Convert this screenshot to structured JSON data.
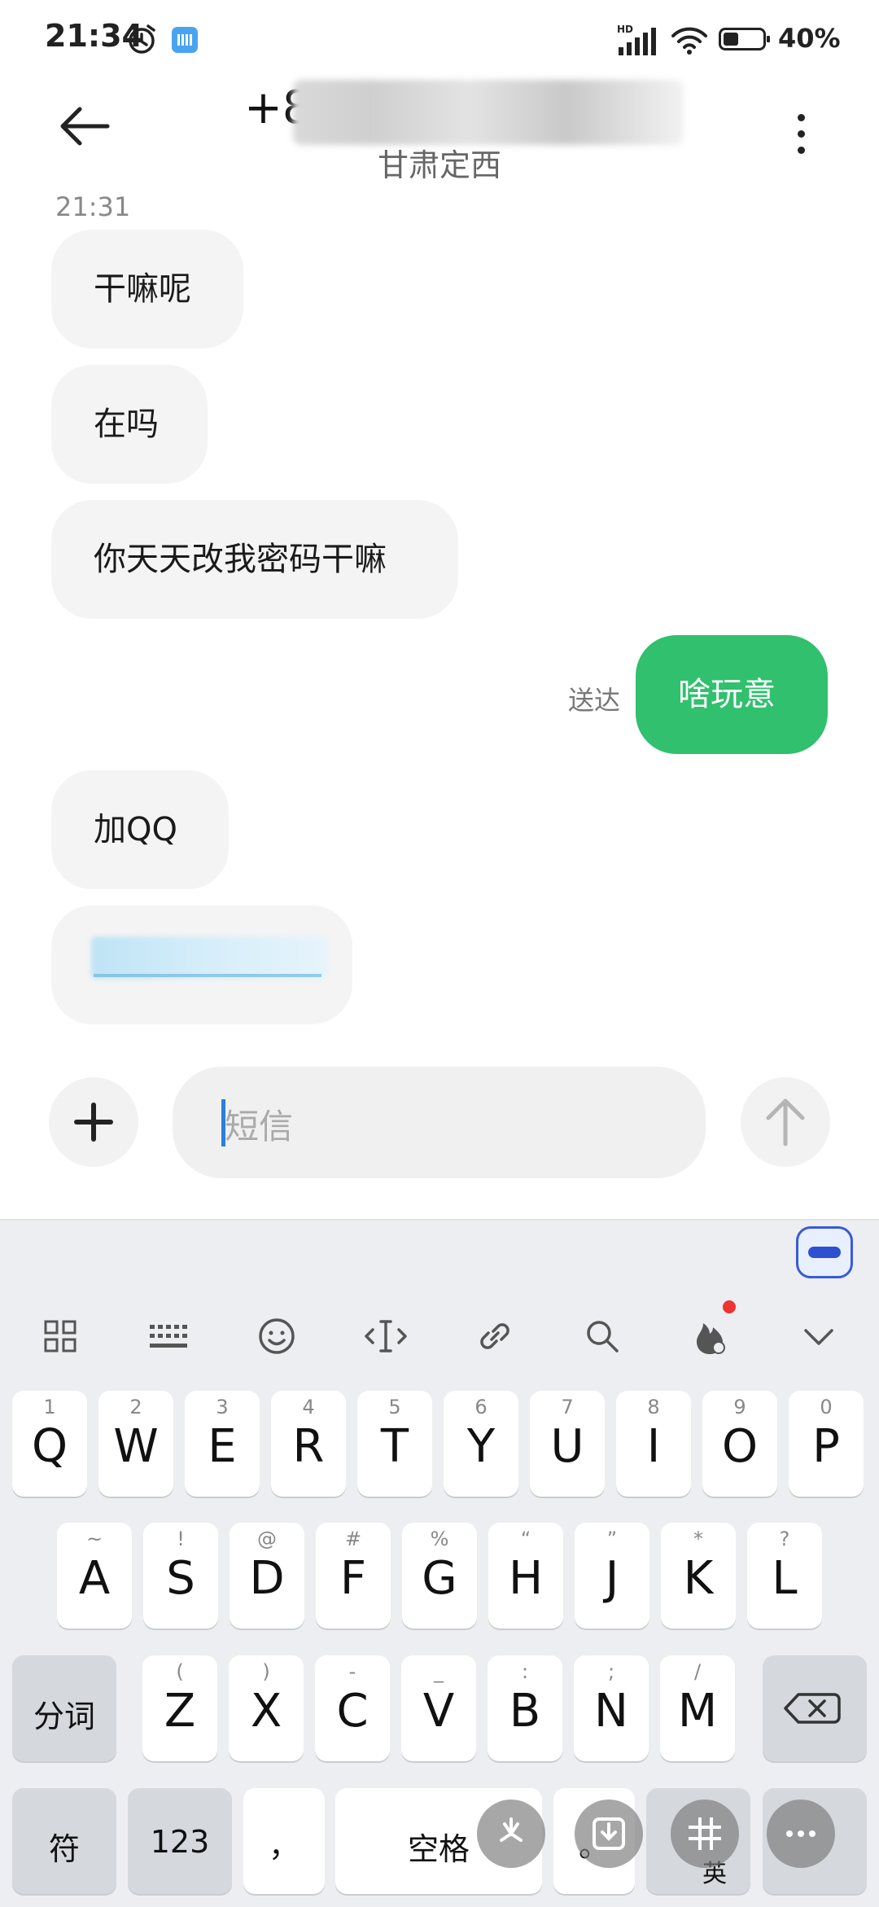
{
  "status": {
    "time": "21:34",
    "network": "HD",
    "battery_pct": "40%",
    "battery_level": 0.4
  },
  "header": {
    "number_visible": "+8",
    "location": "甘肃定西"
  },
  "messages": {
    "timestamp": "21:31",
    "m1": "干嘛呢",
    "m2": "在吗",
    "m3": "你天天改我密码干嘛",
    "sent": "啥玩意",
    "delivered": "送达",
    "m4": "加QQ"
  },
  "composer": {
    "placeholder": "短信"
  },
  "keyboard": {
    "row1": [
      {
        "sub": "1",
        "key": "Q"
      },
      {
        "sub": "2",
        "key": "W"
      },
      {
        "sub": "3",
        "key": "E"
      },
      {
        "sub": "4",
        "key": "R"
      },
      {
        "sub": "5",
        "key": "T"
      },
      {
        "sub": "6",
        "key": "Y"
      },
      {
        "sub": "7",
        "key": "U"
      },
      {
        "sub": "8",
        "key": "I"
      },
      {
        "sub": "9",
        "key": "O"
      },
      {
        "sub": "0",
        "key": "P"
      }
    ],
    "row2": [
      {
        "sub": "~",
        "key": "A"
      },
      {
        "sub": "!",
        "key": "S"
      },
      {
        "sub": "@",
        "key": "D"
      },
      {
        "sub": "#",
        "key": "F"
      },
      {
        "sub": "%",
        "key": "G"
      },
      {
        "sub": "“",
        "key": "H"
      },
      {
        "sub": "”",
        "key": "J"
      },
      {
        "sub": "*",
        "key": "K"
      },
      {
        "sub": "?",
        "key": "L"
      }
    ],
    "row3": [
      {
        "sub": "(",
        "key": "Z"
      },
      {
        "sub": ")",
        "key": "X"
      },
      {
        "sub": "-",
        "key": "C"
      },
      {
        "sub": "_",
        "key": "V"
      },
      {
        "sub": ":",
        "key": "B"
      },
      {
        "sub": ";",
        "key": "N"
      },
      {
        "sub": "/",
        "key": "M"
      }
    ],
    "fenci": "分词",
    "fu": "符",
    "num": "123",
    "comma": "，",
    "space": "空格",
    "period": "。",
    "lang": "英"
  }
}
